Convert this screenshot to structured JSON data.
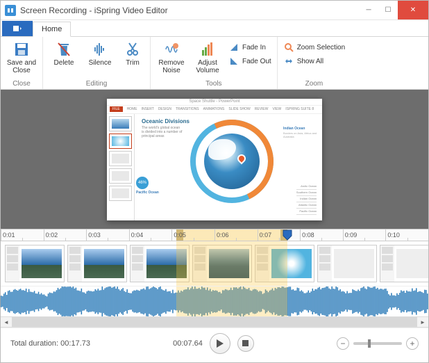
{
  "window": {
    "title": "Screen Recording - iSpring Video Editor"
  },
  "tabs": {
    "home": "Home"
  },
  "ribbon": {
    "close": {
      "label": "Close",
      "save_close": "Save and\nClose"
    },
    "editing": {
      "label": "Editing",
      "delete": "Delete",
      "silence": "Silence",
      "trim": "Trim"
    },
    "tools": {
      "label": "Tools",
      "remove_noise": "Remove\nNoise",
      "adjust_volume": "Adjust\nVolume",
      "fade_in": "Fade In",
      "fade_out": "Fade Out"
    },
    "zoom": {
      "label": "Zoom",
      "zoom_selection": "Zoom Selection",
      "show_all": "Show All"
    }
  },
  "slide": {
    "app_title": "Space Shuttle - PowerPoint",
    "menu": [
      "FILE",
      "HOME",
      "INSERT",
      "DESIGN",
      "TRANSITIONS",
      "ANIMATIONS",
      "SLIDE SHOW",
      "REVIEW",
      "VIEW",
      "ISPRING SUITE 8"
    ],
    "heading": "Oceanic Divisions",
    "subtext": "The world's global ocean is divided into a number of principal areas",
    "pacific_pct": "46%",
    "pacific_label": "Pacific Ocean",
    "indian_label": "Indian Ocean",
    "indian_sub": "Borders on Asia, Africa and Australia",
    "legend": [
      "Arctic Ocean",
      "Southern Ocean",
      "Indian Ocean",
      "Atlantic Ocean",
      "Pacific Ocean"
    ]
  },
  "ruler": {
    "ticks": [
      "0:01",
      "0:02",
      "0:03",
      "0:04",
      "0:05",
      "0:06",
      "0:07",
      "0:08",
      "0:09",
      "0:10"
    ]
  },
  "selection": {
    "left_pct": 41,
    "width_pct": 26
  },
  "playhead_pct": 67,
  "controls": {
    "total_duration_label": "Total duration:",
    "total_duration_value": "00:17.73",
    "current_time": "00:07.64"
  }
}
